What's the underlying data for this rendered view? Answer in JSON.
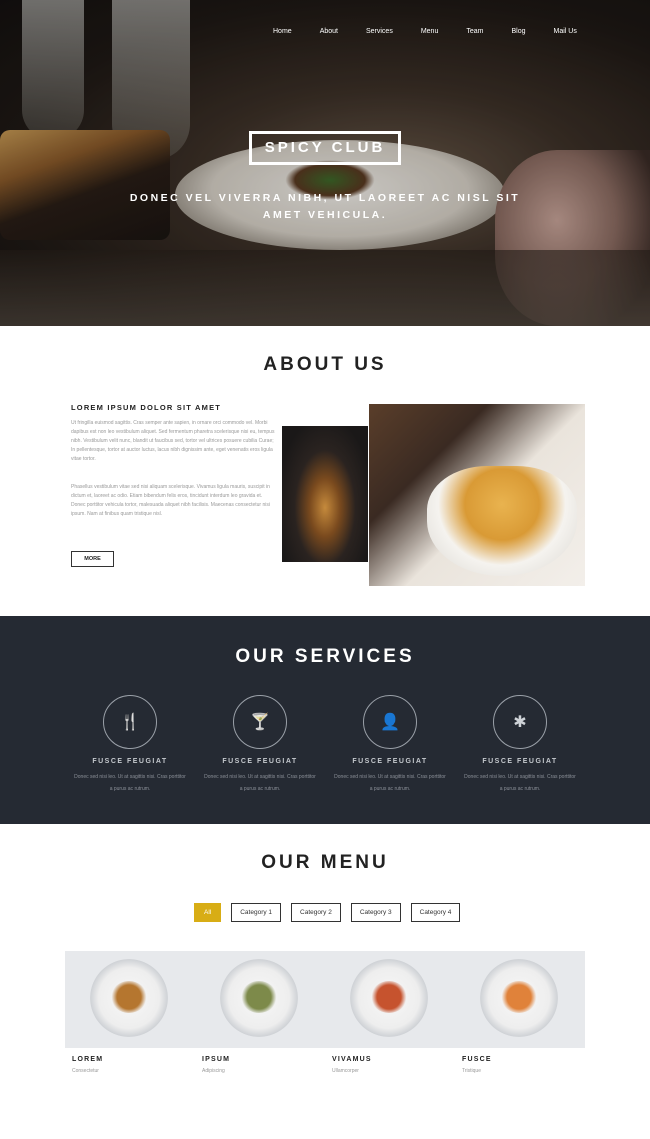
{
  "nav": {
    "items": [
      {
        "label": "Home",
        "boxed": true
      },
      {
        "label": "About",
        "boxed": false
      },
      {
        "label": "Services",
        "boxed": false
      },
      {
        "label": "Menu",
        "boxed": false
      },
      {
        "label": "Team",
        "boxed": false
      },
      {
        "label": "Blog",
        "boxed": true
      },
      {
        "label": "Mail Us",
        "boxed": false
      }
    ]
  },
  "hero": {
    "brand": "SPICY CLUB",
    "tagline": "DONEC VEL VIVERRA NIBH, UT LAOREET AC NISL SIT AMET VEHICULA."
  },
  "about": {
    "title": "ABOUT US",
    "subtitle": "LOREM IPSUM DOLOR SIT AMET",
    "paragraph1": "Ut fringilla euismod sagittis. Cras semper ante sapien, in ornare orci commodo vel. Morbi dapibus est non leo vestibulum aliquet. Sed fermentum pharetra scelerisque nisi eu, tempus nibh. Vestibulum velit nunc, blandit ut faucibus sed, tortor vel ultrices posuere cubilia Curae; In pellentesque, tortor at auctor luctus, lacus nibh dignissim ante, eget venenatis eros ligula vitae tortor.",
    "paragraph2": "Phasellus vestibulum vitae sed nisi aliquam scelerisque. Vivamus ligula mauris, suscipit in dictum et, laoreet ac odio. Etiam bibendum felis eros, tincidunt interdum leo gravida et. Donec porttitor vehicula tortor, malesuada aliquet nibh facilisis. Maecenas consectetur nisi ipsum. Nam at finibus quam tristique nisl.",
    "more_label": "MORE"
  },
  "services": {
    "title": "OUR SERVICES",
    "items": [
      {
        "icon": "cutlery-icon",
        "glyph": "🍴",
        "title": "FUSCE FEUGIAT",
        "text": "Donec sed nisi leo. Ut at sagittis nisi. Cras porttitor a purus ac rutrum."
      },
      {
        "icon": "cocktail-icon",
        "glyph": "🍸",
        "title": "FUSCE FEUGIAT",
        "text": "Donec sed nisi leo. Ut at sagittis nisi. Cras porttitor a purus ac rutrum."
      },
      {
        "icon": "user-icon",
        "glyph": "👤",
        "title": "FUSCE FEUGIAT",
        "text": "Donec sed nisi leo. Ut at sagittis nisi. Cras porttitor a purus ac rutrum."
      },
      {
        "icon": "asterisk-icon",
        "glyph": "✱",
        "title": "FUSCE FEUGIAT",
        "text": "Donec sed nisi leo. Ut at sagittis nisi. Cras porttitor a purus ac rutrum."
      }
    ]
  },
  "menu": {
    "title": "OUR MENU",
    "filters": [
      {
        "label": "All",
        "active": true
      },
      {
        "label": "Category 1",
        "active": false
      },
      {
        "label": "Category 2",
        "active": false
      },
      {
        "label": "Category 3",
        "active": false
      },
      {
        "label": "Category 4",
        "active": false
      }
    ],
    "dishes": [
      {
        "name": "LOREM",
        "desc": "Consectetur",
        "food_color": "#b5762f"
      },
      {
        "name": "IPSUM",
        "desc": "Adipiscing",
        "food_color": "#7d8a4a"
      },
      {
        "name": "VIVAMUS",
        "desc": "Ullamcorper",
        "food_color": "#c6532e"
      },
      {
        "name": "FUSCE",
        "desc": "Tristique",
        "food_color": "#e0823a"
      }
    ]
  },
  "colors": {
    "accent": "#d8ad15",
    "services_bg": "#252a33"
  }
}
